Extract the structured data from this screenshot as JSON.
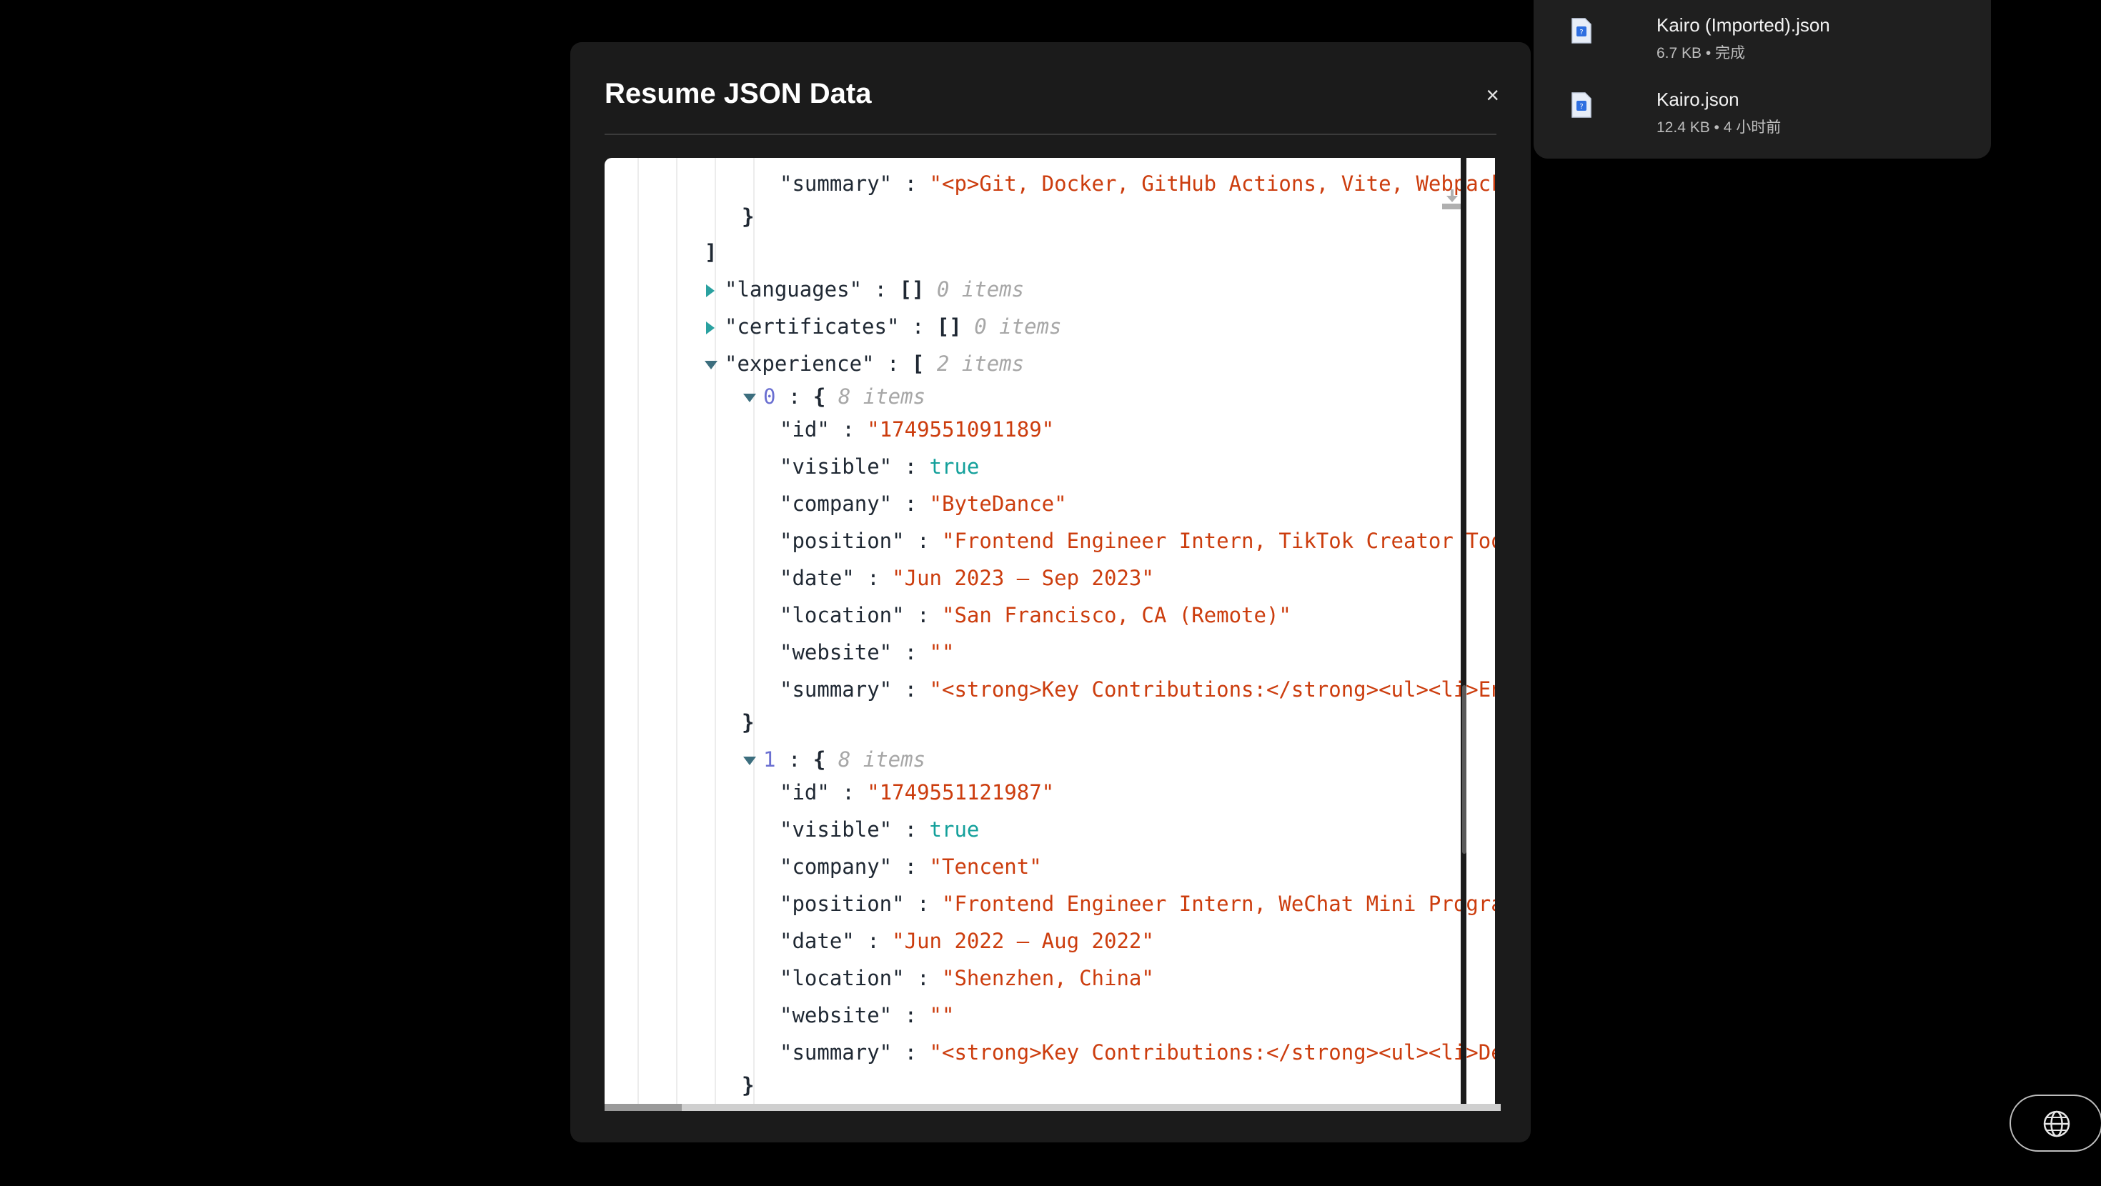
{
  "modal": {
    "title": "Resume JSON Data",
    "close_label": "×"
  },
  "json_view": {
    "prev_summary": {
      "key": "\"summary\"",
      "value": "\"<p>Git, Docker, GitHub Actions, Vite, Webpack,"
    },
    "languages": {
      "key": "\"languages\"",
      "bracket": "[]",
      "count": "0 items"
    },
    "certificates": {
      "key": "\"certificates\"",
      "bracket": "[]",
      "count": "0 items"
    },
    "experience": {
      "key": "\"experience\"",
      "bracket": "[",
      "count": "2 items"
    },
    "entries": [
      {
        "index": "0",
        "bracket": "{",
        "count": "8 items",
        "id": "\"1749551091189\"",
        "visible": "true",
        "company": "\"ByteDance\"",
        "position": "\"Frontend Engineer Intern, TikTok Creator Tool",
        "date": "\"Jun 2023 – Sep 2023\"",
        "location": "\"San Francisco, CA (Remote)\"",
        "website": "\"\"",
        "summary": "\"<strong>Key Contributions:</strong><ul><li>Eng"
      },
      {
        "index": "1",
        "bracket": "{",
        "count": "8 items",
        "id": "\"1749551121987\"",
        "visible": "true",
        "company": "\"Tencent\"",
        "position": "\"Frontend Engineer Intern, WeChat Mini Program",
        "date": "\"Jun 2022 – Aug 2022\"",
        "location": "\"Shenzhen, China\"",
        "website": "\"\"",
        "summary": "\"<strong>Key Contributions:</strong><ul><li>Dev"
      }
    ],
    "keys": {
      "id": "\"id\"",
      "visible": "\"visible\"",
      "company": "\"company\"",
      "position": "\"position\"",
      "date": "\"date\"",
      "location": "\"location\"",
      "website": "\"website\"",
      "summary": "\"summary\""
    },
    "close_brace": "}",
    "close_bracket": "]",
    "colon": ":"
  },
  "downloads": [
    {
      "name": "Kairo (Imported).json",
      "meta": "6.7 KB • 完成"
    },
    {
      "name": "Kairo.json",
      "meta": "12.4 KB • 4 小时前"
    }
  ],
  "colors": {
    "string": "#cc3d0e",
    "boolean": "#13a09b",
    "index": "#6a6fd1",
    "count": "#a7a7a7"
  },
  "icons": [
    "close-icon",
    "download-icon",
    "file-icon",
    "globe-icon",
    "caret-down-icon",
    "caret-right-icon"
  ]
}
